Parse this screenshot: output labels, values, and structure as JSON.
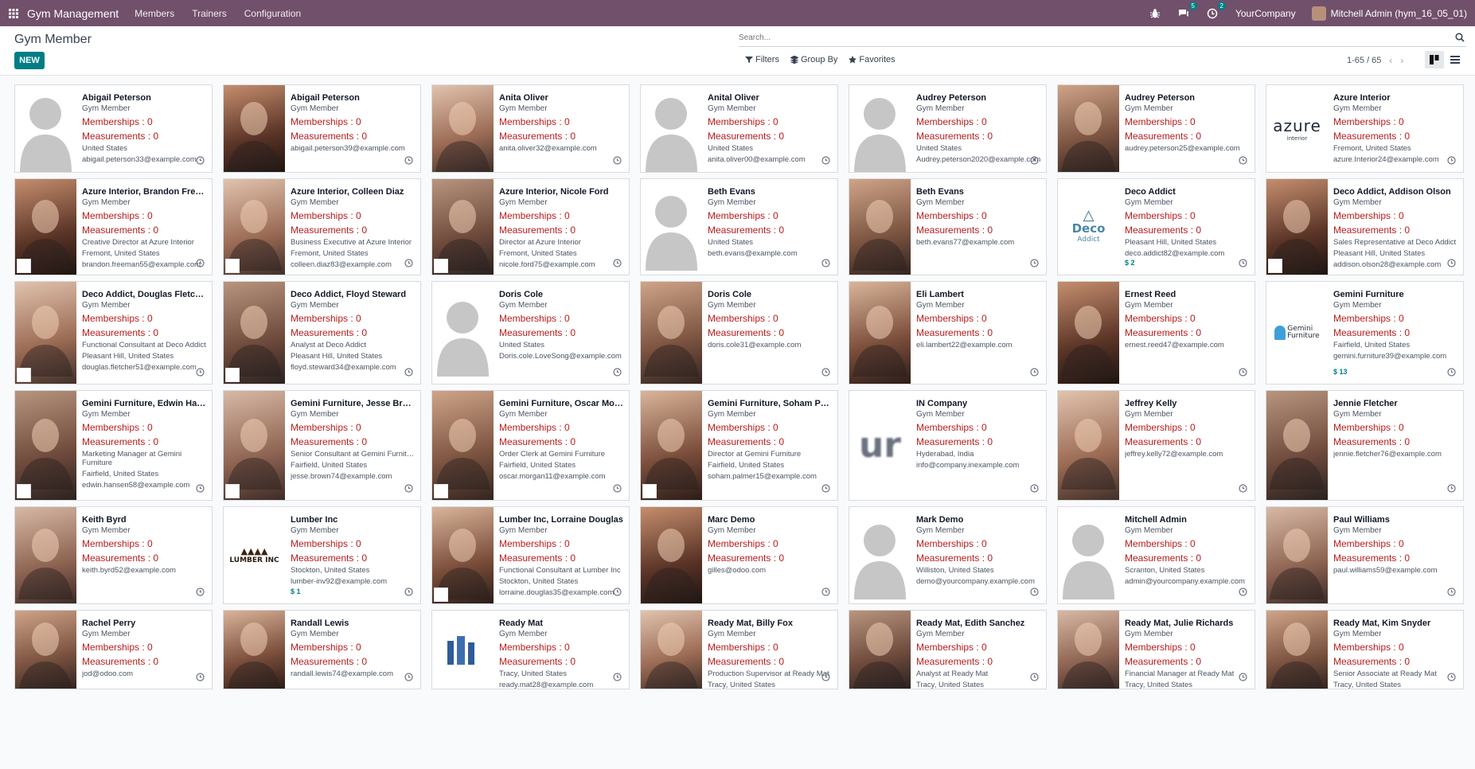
{
  "navbar": {
    "app_name": "Gym Management",
    "menu": [
      "Members",
      "Trainers",
      "Configuration"
    ],
    "messages_badge": "5",
    "activities_badge": "2",
    "company": "YourCompany",
    "user": "Mitchell Admin (hym_16_05_01)"
  },
  "control": {
    "title": "Gym Member",
    "new_label": "NEW",
    "search_placeholder": "Search...",
    "filters_label": "Filters",
    "groupby_label": "Group By",
    "favorites_label": "Favorites",
    "pager": "1-65 / 65"
  },
  "cards": [
    {
      "name": "Abigail Peterson",
      "role": "Gym Member",
      "memberships": "Memberships : 0",
      "measurements": "Measurements : 0",
      "lines": [
        "United States",
        "abigail.peterson33@example.com"
      ],
      "thumb": "avatar"
    },
    {
      "name": "Abigail Peterson",
      "role": "Gym Member",
      "memberships": "Memberships : 0",
      "measurements": "Measurements : 0",
      "lines": [
        "abigail.peterson39@example.com"
      ],
      "thumb": "photo"
    },
    {
      "name": "Anita Oliver",
      "role": "Gym Member",
      "memberships": "Memberships : 0",
      "measurements": "Measurements : 0",
      "lines": [
        "anita.oliver32@example.com"
      ],
      "thumb": "photo"
    },
    {
      "name": "Anital Oliver",
      "role": "Gym Member",
      "memberships": "Memberships : 0",
      "measurements": "Measurements : 0",
      "lines": [
        "United States",
        "anita.oliver00@example.com"
      ],
      "thumb": "avatar"
    },
    {
      "name": "Audrey Peterson",
      "role": "Gym Member",
      "memberships": "Memberships : 0",
      "measurements": "Measurements : 0",
      "lines": [
        "United States",
        "Audrey.peterson2020@example.com"
      ],
      "thumb": "avatar"
    },
    {
      "name": "Audrey Peterson",
      "role": "Gym Member",
      "memberships": "Memberships : 0",
      "measurements": "Measurements : 0",
      "lines": [
        "audrey.peterson25@example.com"
      ],
      "thumb": "photo"
    },
    {
      "name": "Azure Interior",
      "role": "Gym Member",
      "memberships": "Memberships : 0",
      "measurements": "Measurements : 0",
      "lines": [
        "Fremont, United States",
        "azure.Interior24@example.com"
      ],
      "thumb": "logo",
      "logo_text": "azure",
      "logo_sub": "interior"
    },
    {
      "name": "Azure Interior, Brandon Freeman",
      "role": "Gym Member",
      "memberships": "Memberships : 0",
      "measurements": "Measurements : 0",
      "lines": [
        "Creative Director at Azure Interior",
        "Fremont, United States",
        "brandon.freeman55@example.com"
      ],
      "thumb": "photo",
      "mini": "azure"
    },
    {
      "name": "Azure Interior, Colleen Diaz",
      "role": "Gym Member",
      "memberships": "Memberships : 0",
      "measurements": "Measurements : 0",
      "lines": [
        "Business Executive at Azure Interior",
        "Fremont, United States",
        "colleen.diaz83@example.com"
      ],
      "thumb": "photo",
      "mini": "azure"
    },
    {
      "name": "Azure Interior, Nicole Ford",
      "role": "Gym Member",
      "memberships": "Memberships : 0",
      "measurements": "Measurements : 0",
      "lines": [
        "Director at Azure Interior",
        "Fremont, United States",
        "nicole.ford75@example.com"
      ],
      "thumb": "photo",
      "mini": "azure"
    },
    {
      "name": "Beth Evans",
      "role": "Gym Member",
      "memberships": "Memberships : 0",
      "measurements": "Measurements : 0",
      "lines": [
        "United States",
        "beth.evans@example.com"
      ],
      "thumb": "avatar"
    },
    {
      "name": "Beth Evans",
      "role": "Gym Member",
      "memberships": "Memberships : 0",
      "measurements": "Measurements : 0",
      "lines": [
        "beth.evans77@example.com"
      ],
      "thumb": "photo"
    },
    {
      "name": "Deco Addict",
      "role": "Gym Member",
      "memberships": "Memberships : 0",
      "measurements": "Measurements : 0",
      "lines": [
        "Pleasant Hill, United States",
        "deco.addict82@example.com"
      ],
      "thumb": "logo",
      "logo_text": "Deco",
      "logo_sub": "Addict",
      "amount": "$ 2"
    },
    {
      "name": "Deco Addict, Addison Olson",
      "role": "Gym Member",
      "memberships": "Memberships : 0",
      "measurements": "Measurements : 0",
      "lines": [
        "Sales Representative at Deco Addict",
        "Pleasant Hill, United States",
        "addison.olson28@example.com"
      ],
      "thumb": "photo",
      "mini": "deco"
    },
    {
      "name": "Deco Addict, Douglas Fletcher",
      "role": "Gym Member",
      "memberships": "Memberships : 0",
      "measurements": "Measurements : 0",
      "lines": [
        "Functional Consultant at Deco Addict",
        "Pleasant Hill, United States",
        "douglas.fletcher51@example.com"
      ],
      "thumb": "photo",
      "mini": "deco"
    },
    {
      "name": "Deco Addict, Floyd Steward",
      "role": "Gym Member",
      "memberships": "Memberships : 0",
      "measurements": "Measurements : 0",
      "lines": [
        "Analyst at Deco Addict",
        "Pleasant Hill, United States",
        "floyd.steward34@example.com"
      ],
      "thumb": "photo",
      "mini": "deco"
    },
    {
      "name": "Doris Cole",
      "role": "Gym Member",
      "memberships": "Memberships : 0",
      "measurements": "Measurements : 0",
      "lines": [
        "United States",
        "Doris.cole.LoveSong@example.com"
      ],
      "thumb": "avatar"
    },
    {
      "name": "Doris Cole",
      "role": "Gym Member",
      "memberships": "Memberships : 0",
      "measurements": "Measurements : 0",
      "lines": [
        "doris.cole31@example.com"
      ],
      "thumb": "photo"
    },
    {
      "name": "Eli Lambert",
      "role": "Gym Member",
      "memberships": "Memberships : 0",
      "measurements": "Measurements : 0",
      "lines": [
        "eli.lambert22@example.com"
      ],
      "thumb": "photo"
    },
    {
      "name": "Ernest Reed",
      "role": "Gym Member",
      "memberships": "Memberships : 0",
      "measurements": "Measurements : 0",
      "lines": [
        "ernest.reed47@example.com"
      ],
      "thumb": "photo"
    },
    {
      "name": "Gemini Furniture",
      "role": "Gym Member",
      "memberships": "Memberships : 0",
      "measurements": "Measurements : 0",
      "lines": [
        "Fairfield, United States",
        "gemini.furniture39@example.com"
      ],
      "thumb": "logo",
      "logo_text": "Gemini",
      "logo_sub": "Furniture",
      "amount": "$ 13"
    },
    {
      "name": "Gemini Furniture, Edwin Hansen",
      "role": "Gym Member",
      "memberships": "Memberships : 0",
      "measurements": "Measurements : 0",
      "lines": [
        "Marketing Manager at Gemini Furniture",
        "Fairfield, United States",
        "edwin.hansen58@example.com"
      ],
      "thumb": "photo",
      "mini": "gemini",
      "wrap": true
    },
    {
      "name": "Gemini Furniture, Jesse Brown",
      "role": "Gym Member",
      "memberships": "Memberships : 0",
      "measurements": "Measurements : 0",
      "lines": [
        "Senior Consultant at Gemini Furniture",
        "Fairfield, United States",
        "jesse.brown74@example.com"
      ],
      "thumb": "photo",
      "mini": "gemini"
    },
    {
      "name": "Gemini Furniture, Oscar Morgan",
      "role": "Gym Member",
      "memberships": "Memberships : 0",
      "measurements": "Measurements : 0",
      "lines": [
        "Order Clerk at Gemini Furniture",
        "Fairfield, United States",
        "oscar.morgan11@example.com"
      ],
      "thumb": "photo",
      "mini": "gemini"
    },
    {
      "name": "Gemini Furniture, Soham Palmer",
      "role": "Gym Member",
      "memberships": "Memberships : 0",
      "measurements": "Measurements : 0",
      "lines": [
        "Director at Gemini Furniture",
        "Fairfield, United States",
        "soham.palmer15@example.com"
      ],
      "thumb": "photo",
      "mini": "gemini"
    },
    {
      "name": "IN Company",
      "role": "Gym Member",
      "memberships": "Memberships : 0",
      "measurements": "Measurements : 0",
      "lines": [
        "Hyderabad, India",
        "info@company.inexample.com"
      ],
      "thumb": "logo",
      "logo_text": "ur",
      "logo_sub": ""
    },
    {
      "name": "Jeffrey Kelly",
      "role": "Gym Member",
      "memberships": "Memberships : 0",
      "measurements": "Measurements : 0",
      "lines": [
        "jeffrey.kelly72@example.com"
      ],
      "thumb": "photo"
    },
    {
      "name": "Jennie Fletcher",
      "role": "Gym Member",
      "memberships": "Memberships : 0",
      "measurements": "Measurements : 0",
      "lines": [
        "jennie.fletcher76@example.com"
      ],
      "thumb": "photo"
    },
    {
      "name": "Keith Byrd",
      "role": "Gym Member",
      "memberships": "Memberships : 0",
      "measurements": "Measurements : 0",
      "lines": [
        "keith.byrd52@example.com"
      ],
      "thumb": "photo"
    },
    {
      "name": "Lumber Inc",
      "role": "Gym Member",
      "memberships": "Memberships : 0",
      "measurements": "Measurements : 0",
      "lines": [
        "Stockton, United States",
        "lumber-inv92@example.com"
      ],
      "thumb": "logo",
      "logo_text": "LUMBER INC",
      "logo_sub": "",
      "amount": "$ 1"
    },
    {
      "name": "Lumber Inc, Lorraine Douglas",
      "role": "Gym Member",
      "memberships": "Memberships : 0",
      "measurements": "Measurements : 0",
      "lines": [
        "Functional Consultant at Lumber Inc",
        "Stockton, United States",
        "lorraine.douglas35@example.com"
      ],
      "thumb": "photo",
      "mini": "lumber"
    },
    {
      "name": "Marc Demo",
      "role": "Gym Member",
      "memberships": "Memberships : 0",
      "measurements": "Measurements : 0",
      "lines": [
        "gilles@odoo.com"
      ],
      "thumb": "photo"
    },
    {
      "name": "Mark Demo",
      "role": "Gym Member",
      "memberships": "Memberships : 0",
      "measurements": "Measurements : 0",
      "lines": [
        "Williston, United States",
        "demo@yourcompany.example.com"
      ],
      "thumb": "avatar"
    },
    {
      "name": "Mitchell Admin",
      "role": "Gym Member",
      "memberships": "Memberships : 0",
      "measurements": "Measurements : 0",
      "lines": [
        "Scranton, United States",
        "admin@yourcompany.example.com"
      ],
      "thumb": "avatar"
    },
    {
      "name": "Paul Williams",
      "role": "Gym Member",
      "memberships": "Memberships : 0",
      "measurements": "Measurements : 0",
      "lines": [
        "paul.williams59@example.com"
      ],
      "thumb": "photo"
    },
    {
      "name": "Rachel Perry",
      "role": "Gym Member",
      "memberships": "Memberships : 0",
      "measurements": "Measurements : 0",
      "lines": [
        "jod@odoo.com"
      ],
      "thumb": "photo"
    },
    {
      "name": "Randall Lewis",
      "role": "Gym Member",
      "memberships": "Memberships : 0",
      "measurements": "Measurements : 0",
      "lines": [
        "randall.lewis74@example.com"
      ],
      "thumb": "photo"
    },
    {
      "name": "Ready Mat",
      "role": "Gym Member",
      "memberships": "Memberships : 0",
      "measurements": "Measurements : 0",
      "lines": [
        "Tracy, United States",
        "ready.mat28@example.com"
      ],
      "thumb": "logo",
      "logo_text": "",
      "logo_sub": ""
    },
    {
      "name": "Ready Mat, Billy Fox",
      "role": "Gym Member",
      "memberships": "Memberships : 0",
      "measurements": "Measurements : 0",
      "lines": [
        "Production Supervisor at Ready Mat",
        "Tracy, United States"
      ],
      "thumb": "photo"
    },
    {
      "name": "Ready Mat, Edith Sanchez",
      "role": "Gym Member",
      "memberships": "Memberships : 0",
      "measurements": "Measurements : 0",
      "lines": [
        "Analyst at Ready Mat",
        "Tracy, United States"
      ],
      "thumb": "photo"
    },
    {
      "name": "Ready Mat, Julie Richards",
      "role": "Gym Member",
      "memberships": "Memberships : 0",
      "measurements": "Measurements : 0",
      "lines": [
        "Financial Manager at Ready Mat",
        "Tracy, United States"
      ],
      "thumb": "photo"
    },
    {
      "name": "Ready Mat, Kim Snyder",
      "role": "Gym Member",
      "memberships": "Memberships : 0",
      "measurements": "Measurements : 0",
      "lines": [
        "Senior Associate at Ready Mat",
        "Tracy, United States"
      ],
      "thumb": "photo"
    }
  ],
  "colors": {
    "navbar": "#71506b",
    "accent": "#017e84",
    "stat_red": "#b91c1c"
  }
}
